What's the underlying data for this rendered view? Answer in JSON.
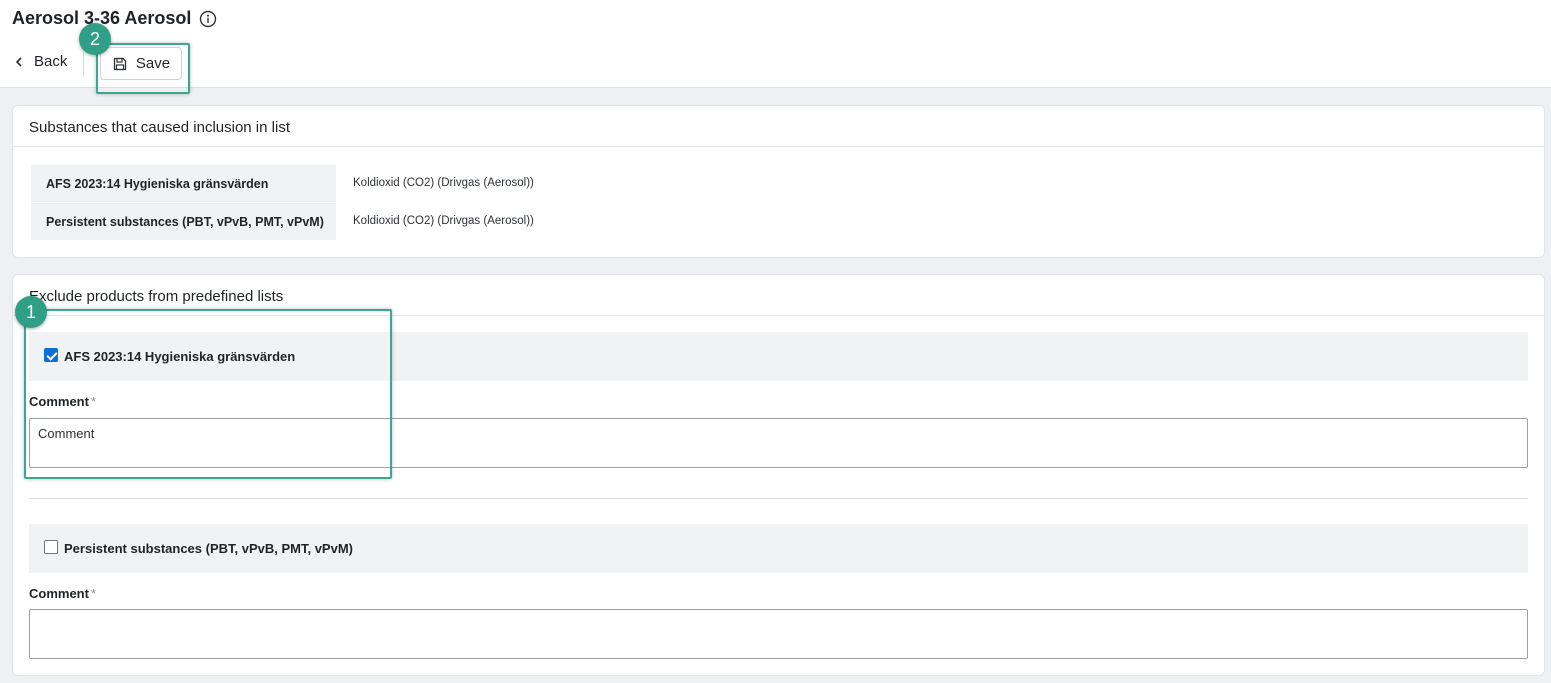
{
  "header": {
    "title": "Aerosol 3-36 Aerosol",
    "back_label": "Back",
    "save_label": "Save"
  },
  "substances_card": {
    "title": "Substances that caused inclusion in list",
    "rows": [
      {
        "list": "AFS 2023:14 Hygieniska gränsvärden",
        "substance": "Koldioxid (CO2) (Drivgas (Aerosol))"
      },
      {
        "list": "Persistent substances (PBT, vPvB, PMT, vPvM)",
        "substance": "Koldioxid (CO2) (Drivgas (Aerosol))"
      }
    ]
  },
  "exclude_card": {
    "title": "Exclude products from predefined lists",
    "items": [
      {
        "label": "AFS 2023:14 Hygieniska gränsvärden",
        "checked": true,
        "comment_label": "Comment",
        "required_mark": "*",
        "comment_placeholder": "Comment",
        "comment_value": ""
      },
      {
        "label": "Persistent substances (PBT, vPvB, PMT, vPvM)",
        "checked": false,
        "comment_label": "Comment",
        "required_mark": "*",
        "comment_placeholder": "",
        "comment_value": ""
      }
    ]
  },
  "annotations": [
    {
      "number": "1"
    },
    {
      "number": "2"
    }
  ],
  "colors": {
    "accent_highlight": "#3aa88d",
    "badge": "#2f9f86",
    "checkbox_checked": "#0a6fd8"
  }
}
